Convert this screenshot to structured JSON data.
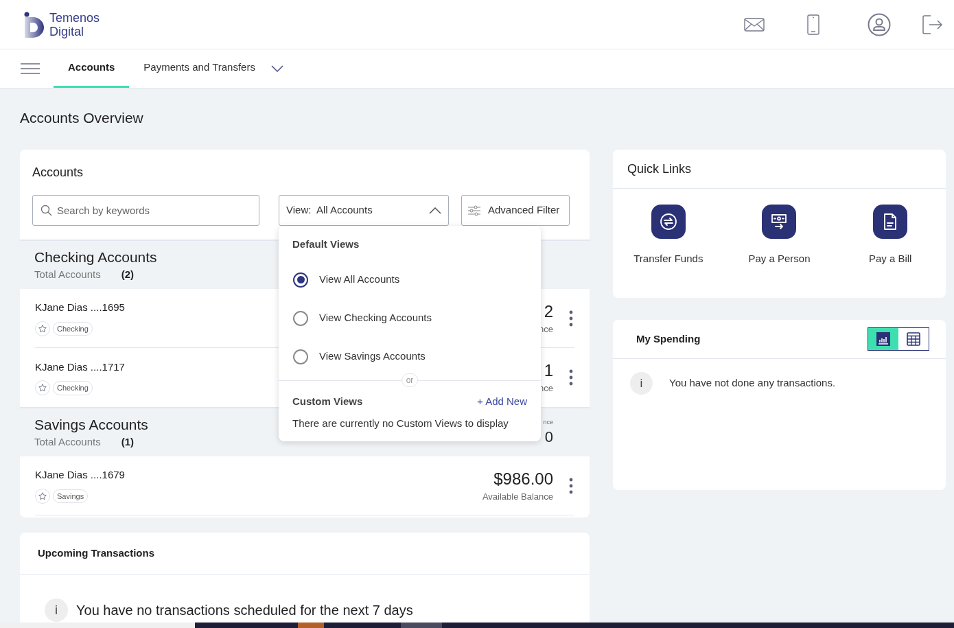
{
  "header": {
    "logo_lines": [
      "Temenos",
      "Digital"
    ]
  },
  "nav": {
    "tabs": [
      {
        "label": "Accounts",
        "selected": true
      },
      {
        "label": "Payments and Transfers",
        "selected": false
      }
    ]
  },
  "page_title": "Accounts Overview",
  "accounts_card": {
    "title": "Accounts",
    "search": {
      "placeholder": "Search by keywords"
    },
    "view_select": {
      "label": "View:  All Accounts",
      "expanded": true
    },
    "advanced_filter": "Advanced Filter",
    "groups": [
      {
        "title": "Checking Accounts",
        "total_label": "Total Accounts",
        "count": "(2)",
        "accounts": [
          {
            "name": "KJane Dias ....1695",
            "tag": "Checking",
            "favorite": false,
            "balance": "2",
            "balance_label": "nce"
          },
          {
            "name": "KJane Dias ....1717",
            "tag": "Checking",
            "favorite": false,
            "balance": "1",
            "balance_label": "nce"
          }
        ]
      },
      {
        "title": "Savings Accounts",
        "total_label": "Total Accounts",
        "count": "(1)",
        "balance_label": "nce",
        "balance": "0",
        "accounts": [
          {
            "name": "KJane Dias ....1679",
            "tag": "Savings",
            "favorite": false,
            "balance": "$986.00",
            "balance_label": "Available Balance"
          }
        ]
      }
    ]
  },
  "view_menu": {
    "default_title": "Default Views",
    "options": [
      {
        "label": "View All Accounts",
        "selected": true
      },
      {
        "label": "View Checking Accounts",
        "selected": false
      },
      {
        "label": "View Savings Accounts",
        "selected": false
      }
    ],
    "divider_label": "or",
    "custom_title": "Custom Views",
    "add_new": "+ Add New",
    "empty_text": "There are currently no Custom Views to display"
  },
  "quick_links": {
    "title": "Quick Links",
    "links": [
      {
        "kind": "transfer",
        "label": "Transfer Funds"
      },
      {
        "kind": "person",
        "label": "Pay a Person"
      },
      {
        "kind": "bill",
        "label": "Pay a Bill"
      }
    ]
  },
  "spending": {
    "title": "My Spending",
    "views": [
      {
        "kind": "chart",
        "selected": true
      },
      {
        "kind": "table",
        "selected": false
      }
    ],
    "info_mark": "i",
    "message": "You have not done any transactions."
  },
  "upcoming": {
    "title": "Upcoming Transactions",
    "info_mark": "i",
    "message": "You have no transactions scheduled for the next 7 days"
  }
}
